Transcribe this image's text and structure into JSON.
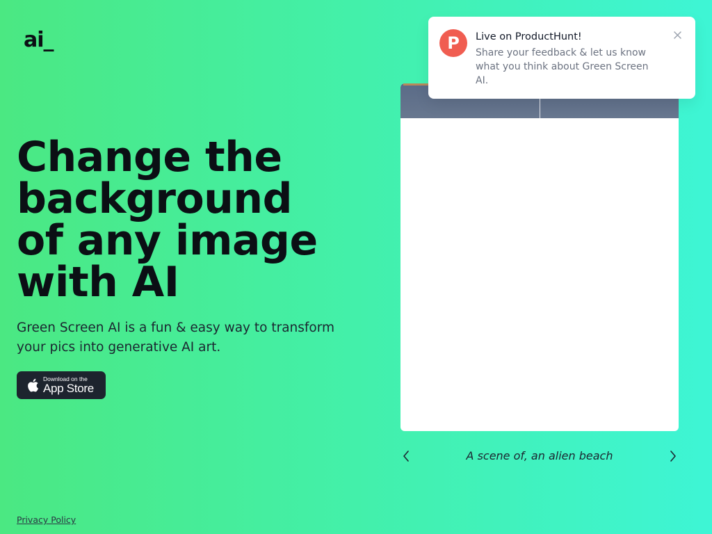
{
  "header": {
    "logo_text": "ai_"
  },
  "hero": {
    "headline": "Change the background of any image with AI",
    "subtitle": "Green Screen AI is a fun & easy way to transform your pics into generative AI art."
  },
  "app_store_button": {
    "small_text": "Download on the",
    "big_text": "App Store",
    "icon": "apple-icon"
  },
  "carousel": {
    "caption": "A scene of, an alien beach",
    "prev_icon": "chevron-left-icon",
    "next_icon": "chevron-right-icon"
  },
  "footer": {
    "privacy_link": "Privacy Policy"
  },
  "notification": {
    "badge_letter": "P",
    "title": "Live on ProductHunt!",
    "message": "Share your feedback & let us know what you think about Green Screen AI.",
    "close_icon": "close-icon"
  },
  "colors": {
    "gradient_start": "#4be882",
    "gradient_end": "#3ef5d5",
    "producthunt": "#f05d51",
    "button_bg": "#1d242e"
  }
}
